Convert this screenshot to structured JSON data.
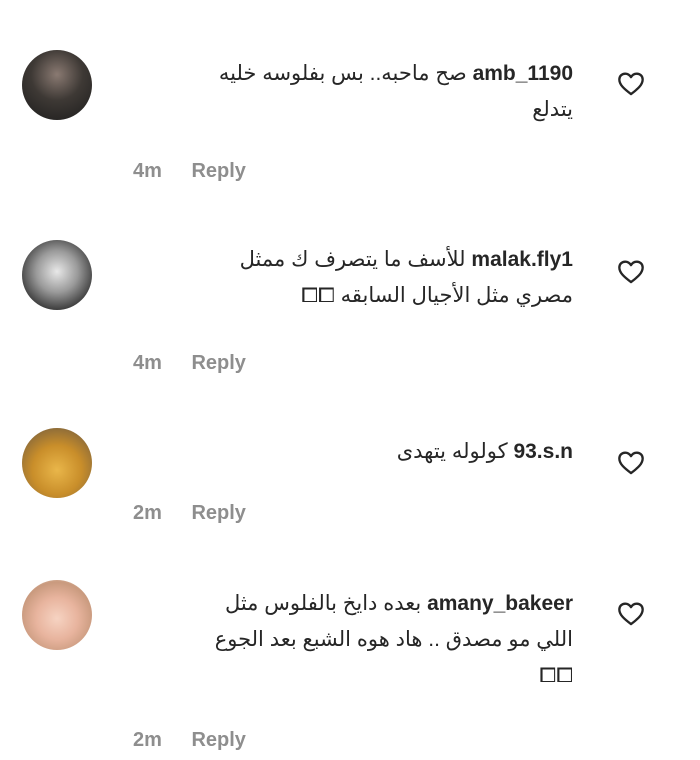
{
  "comments": [
    {
      "username": "amb_1190",
      "text_line1": "صح ماحبه.. بس بفلوسه خليه",
      "text_line2": "يتدلع",
      "time": "4m",
      "reply_label": "Reply"
    },
    {
      "username": "malak.fly1",
      "text_line1": "للأسف ما يتصرف ك ممثل",
      "text_line2": "مصري مثل الأجيال السابقه ⧠⧠",
      "time": "4m",
      "reply_label": "Reply"
    },
    {
      "username": "93.s.n",
      "text_line1": "كولوله يتهدى",
      "text_line2": "",
      "time": "2m",
      "reply_label": "Reply"
    },
    {
      "username": "amany_bakeer",
      "text_line1": "بعده دايخ بالفلوس مثل",
      "text_line2": "اللي مو مصدق .. هاد هوه الشبع بعد الجوع",
      "text_line3": "⧠⧠",
      "time": "2m",
      "reply_label": "Reply"
    }
  ],
  "icons": {
    "like": "heart-outline-icon"
  },
  "colors": {
    "username": "#262626",
    "meta": "#8e8e8e"
  }
}
